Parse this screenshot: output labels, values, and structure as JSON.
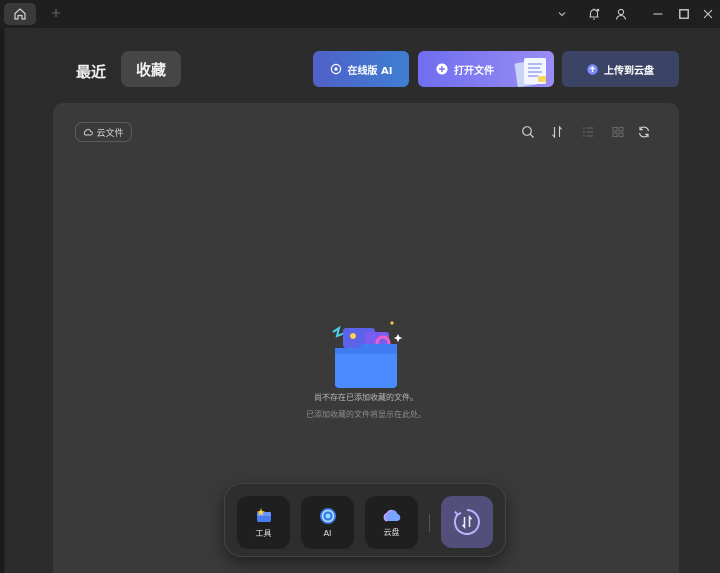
{
  "tabs": {
    "recent": "最近",
    "favorites": "收藏"
  },
  "actions": {
    "online_ai": "在线版 AI",
    "open_file": "打开文件",
    "upload_cloud": "上传到云盘"
  },
  "card": {
    "cloud_filter": "云文件",
    "empty_title": "尚不存在已添加收藏的文件。",
    "empty_subtitle": "已添加收藏的文件将显示在此处。"
  },
  "dock": {
    "tools": "工具",
    "ai": "AI",
    "cloud": "云盘"
  },
  "icons": {
    "titlebar": [
      "home-icon",
      "plus-icon",
      "chevron-down-icon",
      "bell-icon",
      "user-icon",
      "minimize-icon",
      "maximize-icon",
      "close-icon"
    ],
    "toolbar": [
      "search-icon",
      "sort-icon",
      "list-view-icon",
      "grid-view-icon",
      "refresh-icon"
    ]
  },
  "colors": {
    "accent_ai": "#4870cc",
    "accent_open": "#8580f2",
    "upload_bg": "#3c4466"
  }
}
